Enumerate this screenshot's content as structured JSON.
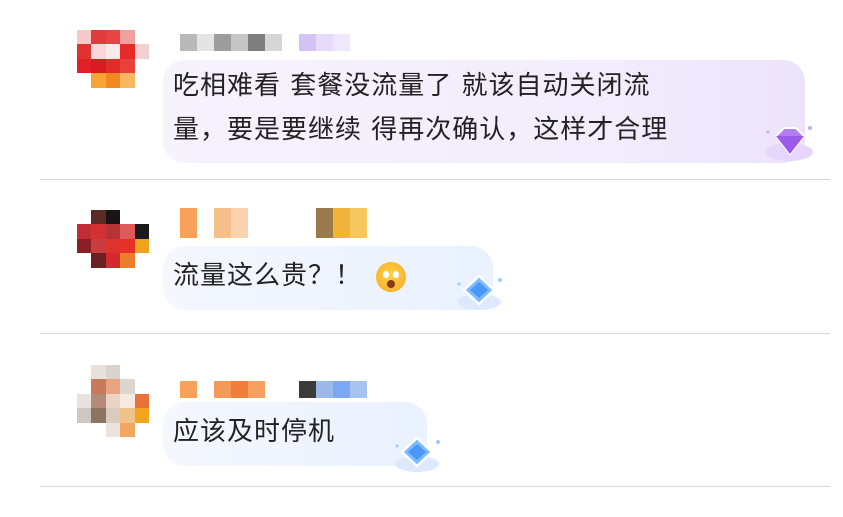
{
  "comments": [
    {
      "text": "吃相难看 套餐没流量了 就该自动关闭流\n量，要是要继续 得再次确认，这样才合理",
      "badge_icon": "purple-diamond-badge-icon",
      "bubble_color": "#f3eefc"
    },
    {
      "text": "流量这么贵？！",
      "emoji_icon": "astonished-face-emoji-icon",
      "badge_icon": "blue-diamond-badge-icon",
      "bubble_color": "#eef4ff"
    },
    {
      "text": "应该及时停机",
      "badge_icon": "blue-diamond-badge-icon",
      "bubble_color": "#eef4ff"
    }
  ],
  "colors": {
    "text": "#222222",
    "divider": "#d9d9d9",
    "purple_badge": "#a86cf0",
    "blue_badge": "#5aa8ff"
  }
}
